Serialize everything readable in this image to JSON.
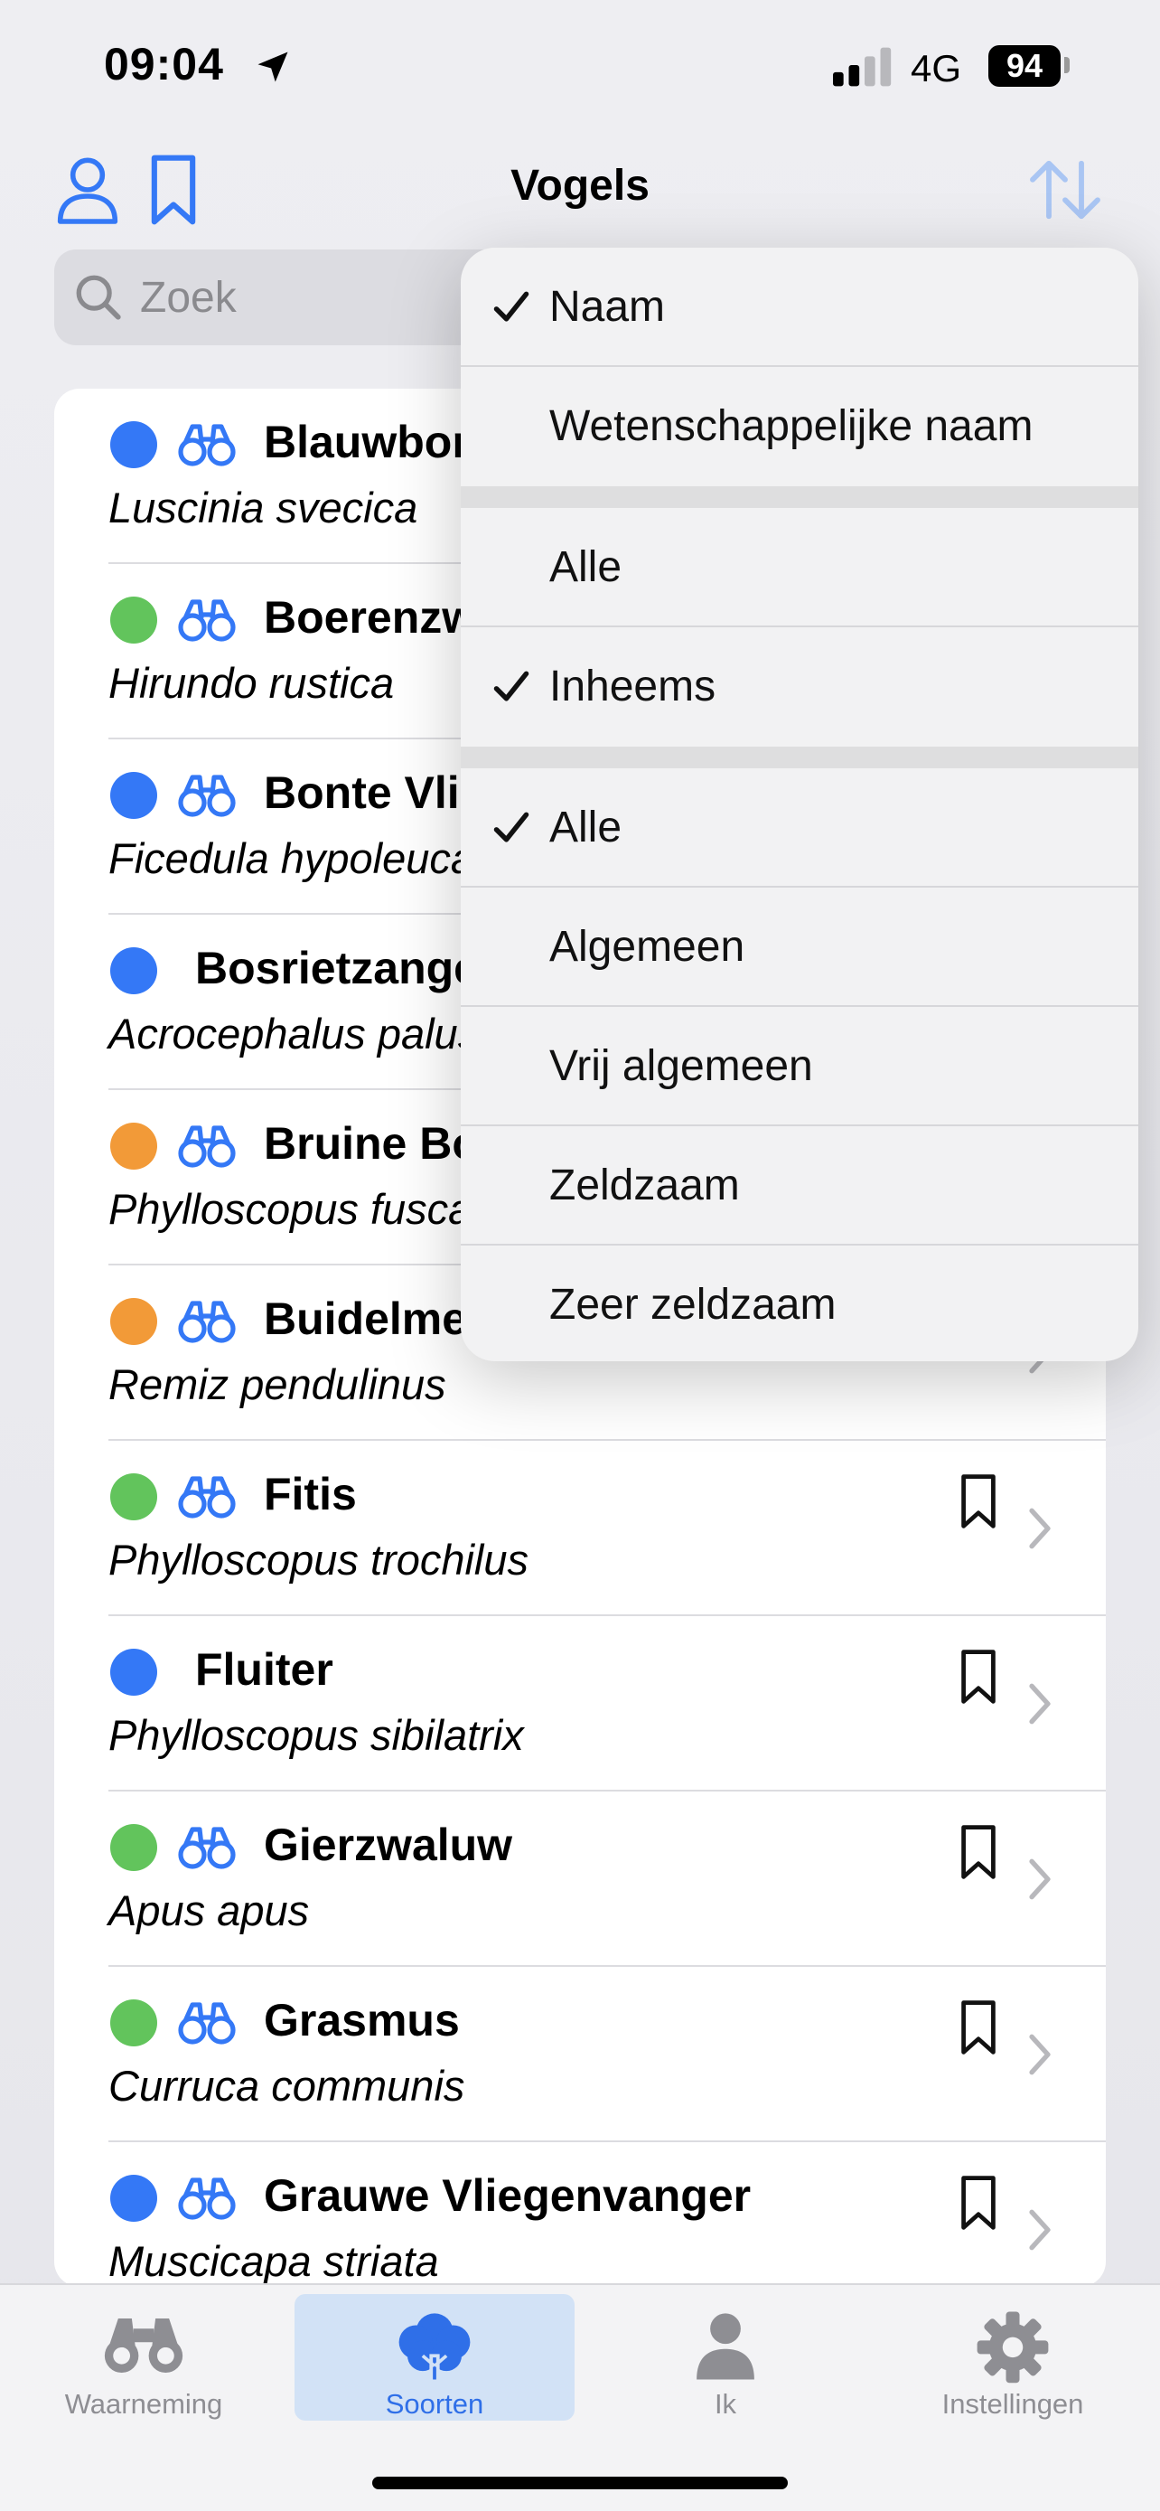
{
  "status": {
    "time": "09:04",
    "network": "4G",
    "battery": "94"
  },
  "nav": {
    "title": "Vogels"
  },
  "search": {
    "placeholder": "Zoek"
  },
  "colors": {
    "blue": "#3478f6",
    "green": "#62c45c",
    "orange": "#f29a38",
    "accent": "#2f6fe8"
  },
  "species": [
    {
      "name": "Blauwborst",
      "scientific": "Luscinia svecica",
      "status": "blue",
      "binoculars": true
    },
    {
      "name": "Boerenzwaluw",
      "scientific": "Hirundo rustica",
      "status": "green",
      "binoculars": true
    },
    {
      "name": "Bonte Vliegenvanger",
      "scientific": "Ficedula hypoleuca",
      "status": "blue",
      "binoculars": true
    },
    {
      "name": "Bosrietzanger",
      "scientific": "Acrocephalus palustris",
      "status": "blue",
      "binoculars": false
    },
    {
      "name": "Bruine Boszanger",
      "scientific": "Phylloscopus fuscatus",
      "status": "orange",
      "binoculars": true
    },
    {
      "name": "Buidelmees",
      "scientific": "Remiz pendulinus",
      "status": "orange",
      "binoculars": true
    },
    {
      "name": "Fitis",
      "scientific": "Phylloscopus trochilus",
      "status": "green",
      "binoculars": true
    },
    {
      "name": "Fluiter",
      "scientific": "Phylloscopus sibilatrix",
      "status": "blue",
      "binoculars": false
    },
    {
      "name": "Gierzwaluw",
      "scientific": "Apus apus",
      "status": "green",
      "binoculars": true
    },
    {
      "name": "Grasmus",
      "scientific": "Curruca communis",
      "status": "green",
      "binoculars": true
    },
    {
      "name": "Grauwe Vliegenvanger",
      "scientific": "Muscicapa striata",
      "status": "blue",
      "binoculars": true
    }
  ],
  "menu": {
    "sort": [
      {
        "label": "Naam",
        "checked": true
      },
      {
        "label": "Wetenschappelijke naam",
        "checked": false
      }
    ],
    "origin": [
      {
        "label": "Alle",
        "checked": false
      },
      {
        "label": "Inheems",
        "checked": true
      }
    ],
    "rarity": [
      {
        "label": "Alle",
        "checked": true
      },
      {
        "label": "Algemeen",
        "checked": false
      },
      {
        "label": "Vrij algemeen",
        "checked": false
      },
      {
        "label": "Zeldzaam",
        "checked": false
      },
      {
        "label": "Zeer zeldzaam",
        "checked": false
      }
    ]
  },
  "tabs": [
    {
      "label": "Waarneming",
      "icon": "binoculars-icon",
      "active": false
    },
    {
      "label": "Soorten",
      "icon": "tree-icon",
      "active": true
    },
    {
      "label": "Ik",
      "icon": "person-icon",
      "active": false
    },
    {
      "label": "Instellingen",
      "icon": "gear-icon",
      "active": false
    }
  ]
}
